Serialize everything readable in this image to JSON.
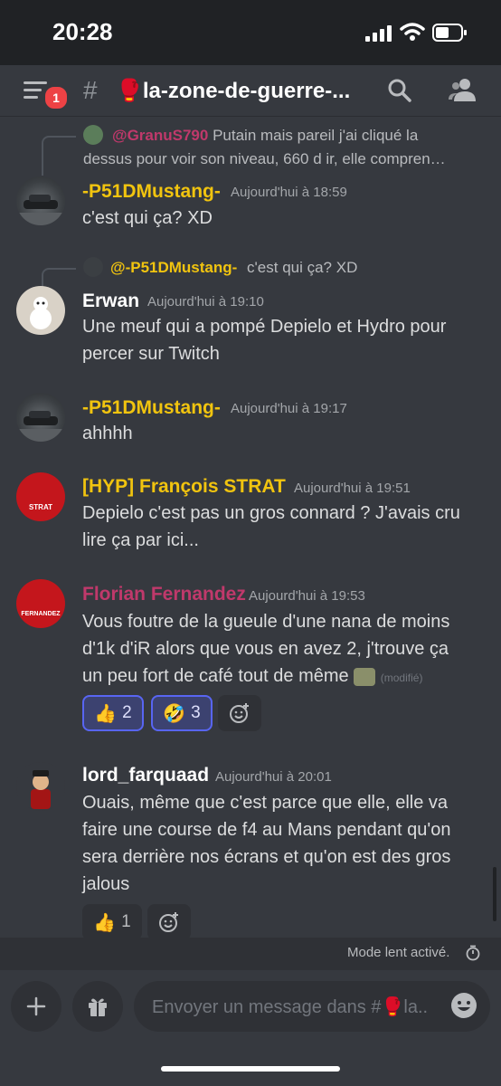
{
  "status": {
    "time": "20:28"
  },
  "header": {
    "badge": "1",
    "channel": "🥊la-zone-de-guerre-..."
  },
  "messages": [
    {
      "reply": {
        "name": "@GranuS790",
        "text": "Putain mais pareil j'ai cliqué la",
        "text2": "dessus pour voir son niveau, 660 d ir, elle compren…",
        "color": "#c0396b"
      },
      "author": "-P51DMustang-",
      "color": "#f1c40f",
      "time": "Aujourd'hui à 18:59",
      "lines": [
        "c'est qui ça? XD"
      ]
    },
    {
      "reply": {
        "name": "@-P51DMustang-",
        "text": "c'est qui ça? XD",
        "color": "#f1c40f"
      },
      "author": "Erwan",
      "color": "#ffffff",
      "time": "Aujourd'hui à 19:10",
      "lines": [
        "Une meuf qui a pompé Depielo et Hydro pour",
        "percer sur Twitch"
      ]
    },
    {
      "author": "-P51DMustang-",
      "color": "#f1c40f",
      "time": "Aujourd'hui à 19:17",
      "lines": [
        "ahhhh"
      ]
    },
    {
      "author": "[HYP] François STRAT",
      "color": "#f1c40f",
      "time": "Aujourd'hui à 19:51",
      "avatar_text": "STRAT",
      "lines": [
        "Depielo c'est pas un gros connard ? J'avais cru",
        "lire ça par ici..."
      ]
    },
    {
      "author": "Florian Fernandez",
      "color": "#c0396b",
      "time": "Aujourd'hui à 19:53",
      "avatar_text": "FERNANDEZ",
      "lines": [
        "Vous foutre de la gueule d'une nana de moins",
        "d'1k d'iR alors que vous en avez 2, j'trouve ça",
        "un peu fort de café tout de même"
      ],
      "edited": "(modifié)",
      "reactions": [
        {
          "emoji": "👍",
          "count": "2"
        },
        {
          "emoji": "🤣",
          "count": "3"
        }
      ]
    },
    {
      "author": "lord_farquaad",
      "color": "#ffffff",
      "time": "Aujourd'hui à 20:01",
      "lines": [
        "Ouais, même que c'est parce que elle, elle va",
        "faire une course de f4 au Mans pendant qu'on",
        "sera derrière nos écrans et qu'on est des gros",
        "jalous"
      ],
      "reactions": [
        {
          "emoji": "👍",
          "count": "1"
        }
      ]
    }
  ],
  "slowmode": {
    "label": "Mode lent activé."
  },
  "composer": {
    "placeholder": "Envoyer un message dans #🥊la.."
  },
  "colors": {
    "background": "#36393f",
    "dark": "#202225",
    "blurple": "#5865f2",
    "gold": "#f1c40f",
    "pink": "#c0396b",
    "red": "#ed4245"
  },
  "icons": [
    "menu-icon",
    "hash-icon",
    "search-icon",
    "members-icon",
    "add-reaction-icon",
    "plus-icon",
    "gift-icon",
    "emoji-icon",
    "timer-icon"
  ]
}
